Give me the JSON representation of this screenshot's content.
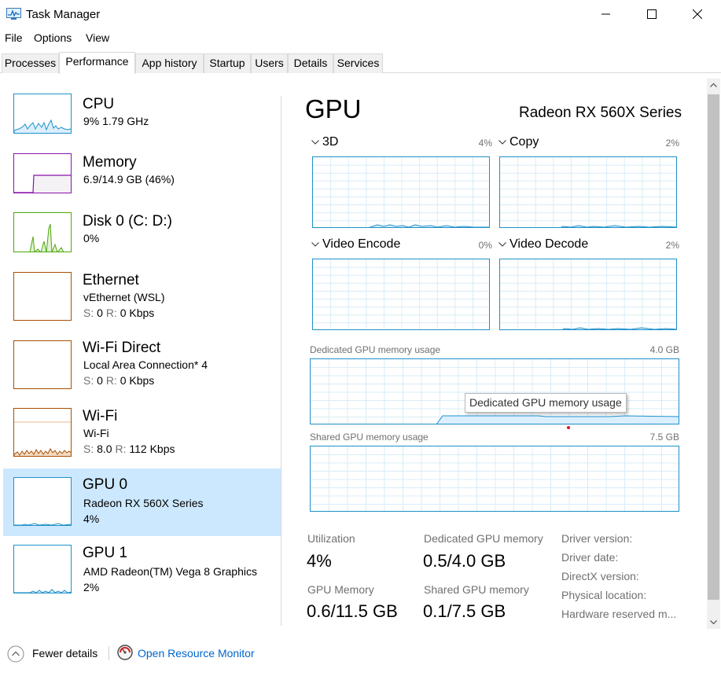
{
  "window": {
    "title": "Task Manager"
  },
  "menu": [
    "File",
    "Options",
    "View"
  ],
  "tabs": [
    "Processes",
    "Performance",
    "App history",
    "Startup",
    "Users",
    "Details",
    "Services"
  ],
  "active_tab": "Performance",
  "sidebar": {
    "cpu": {
      "title": "CPU",
      "line1": "9%  1.79 GHz"
    },
    "memory": {
      "title": "Memory",
      "line1": "6.9/14.9 GB (46%)"
    },
    "disk": {
      "title": "Disk 0 (C: D:)",
      "line1": "0%"
    },
    "ethernet": {
      "title": "Ethernet",
      "line1": "vEthernet (WSL)",
      "s_label": "S:",
      "s_value": "0",
      "r_label": "R:",
      "r_value": "0 Kbps"
    },
    "wifi_direct": {
      "title": "Wi-Fi Direct",
      "line1": "Local Area Connection* 4",
      "s_label": "S:",
      "s_value": "0",
      "r_label": "R:",
      "r_value": "0 Kbps"
    },
    "wifi": {
      "title": "Wi-Fi",
      "line1": "Wi-Fi",
      "s_label": "S:",
      "s_value": "8.0",
      "r_label": "R:",
      "r_value": "112 Kbps"
    },
    "gpu0": {
      "title": "GPU 0",
      "line1": "Radeon RX 560X Series",
      "line2": "4%"
    },
    "gpu1": {
      "title": "GPU 1",
      "line1": "AMD Radeon(TM) Vega 8 Graphics",
      "line2": "2%"
    }
  },
  "main": {
    "heading": "GPU",
    "model": "Radeon RX 560X Series",
    "engines": [
      {
        "name": "3D",
        "pct": "4%"
      },
      {
        "name": "Copy",
        "pct": "2%"
      },
      {
        "name": "Video Encode",
        "pct": "0%"
      },
      {
        "name": "Video Decode",
        "pct": "2%"
      }
    ],
    "dedicated": {
      "label": "Dedicated GPU memory usage",
      "max": "4.0 GB",
      "tooltip": "Dedicated GPU memory usage"
    },
    "shared": {
      "label": "Shared GPU memory usage",
      "max": "7.5 GB"
    },
    "stats": {
      "utilization": {
        "label": "Utilization",
        "value": "4%"
      },
      "dedicated_memory": {
        "label": "Dedicated GPU memory",
        "value": "0.5/4.0 GB"
      },
      "gpu_memory": {
        "label": "GPU Memory",
        "value": "0.6/11.5 GB"
      },
      "shared_memory": {
        "label": "Shared GPU memory",
        "value": "0.1/7.5 GB"
      }
    },
    "driver_labels": [
      "Driver version:",
      "Driver date:",
      "DirectX version:",
      "Physical location:",
      "Hardware reserved m..."
    ]
  },
  "footer": {
    "fewer_details": "Fewer details",
    "open_resource_monitor": "Open Resource Monitor"
  },
  "colors": {
    "accent": "#1e90c8",
    "memory": "#8b12ae",
    "disk": "#4da60c",
    "network": "#a74f01",
    "selected": "#cce8ff",
    "link": "#0066cc"
  }
}
